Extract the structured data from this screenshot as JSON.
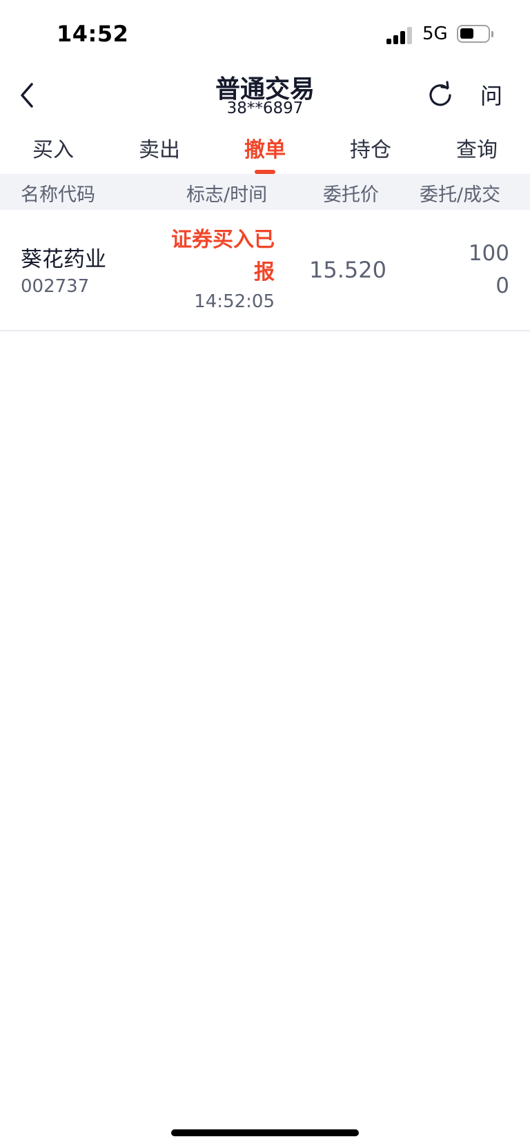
{
  "status_bar": {
    "time": "14:52",
    "network": "5G"
  },
  "header": {
    "title": "普通交易",
    "account": "38**6897",
    "help_label": "问"
  },
  "tabs": [
    {
      "label": "买入"
    },
    {
      "label": "卖出"
    },
    {
      "label": "撤单",
      "active": true
    },
    {
      "label": "持仓"
    },
    {
      "label": "查询"
    }
  ],
  "table": {
    "columns": [
      "名称代码",
      "标志/时间",
      "委托价",
      "委托/成交"
    ],
    "rows": [
      {
        "name": "葵花药业",
        "code": "002737",
        "status": "证券买入已报",
        "time": "14:52:05",
        "price": "15.520",
        "entrust": "100",
        "filled": "0"
      }
    ]
  },
  "colors": {
    "accent": "#f0462a",
    "text_primary": "#161a2c",
    "text_secondary": "#5b6172",
    "header_bg": "#f2f3f7"
  },
  "battery_level": 0.5
}
